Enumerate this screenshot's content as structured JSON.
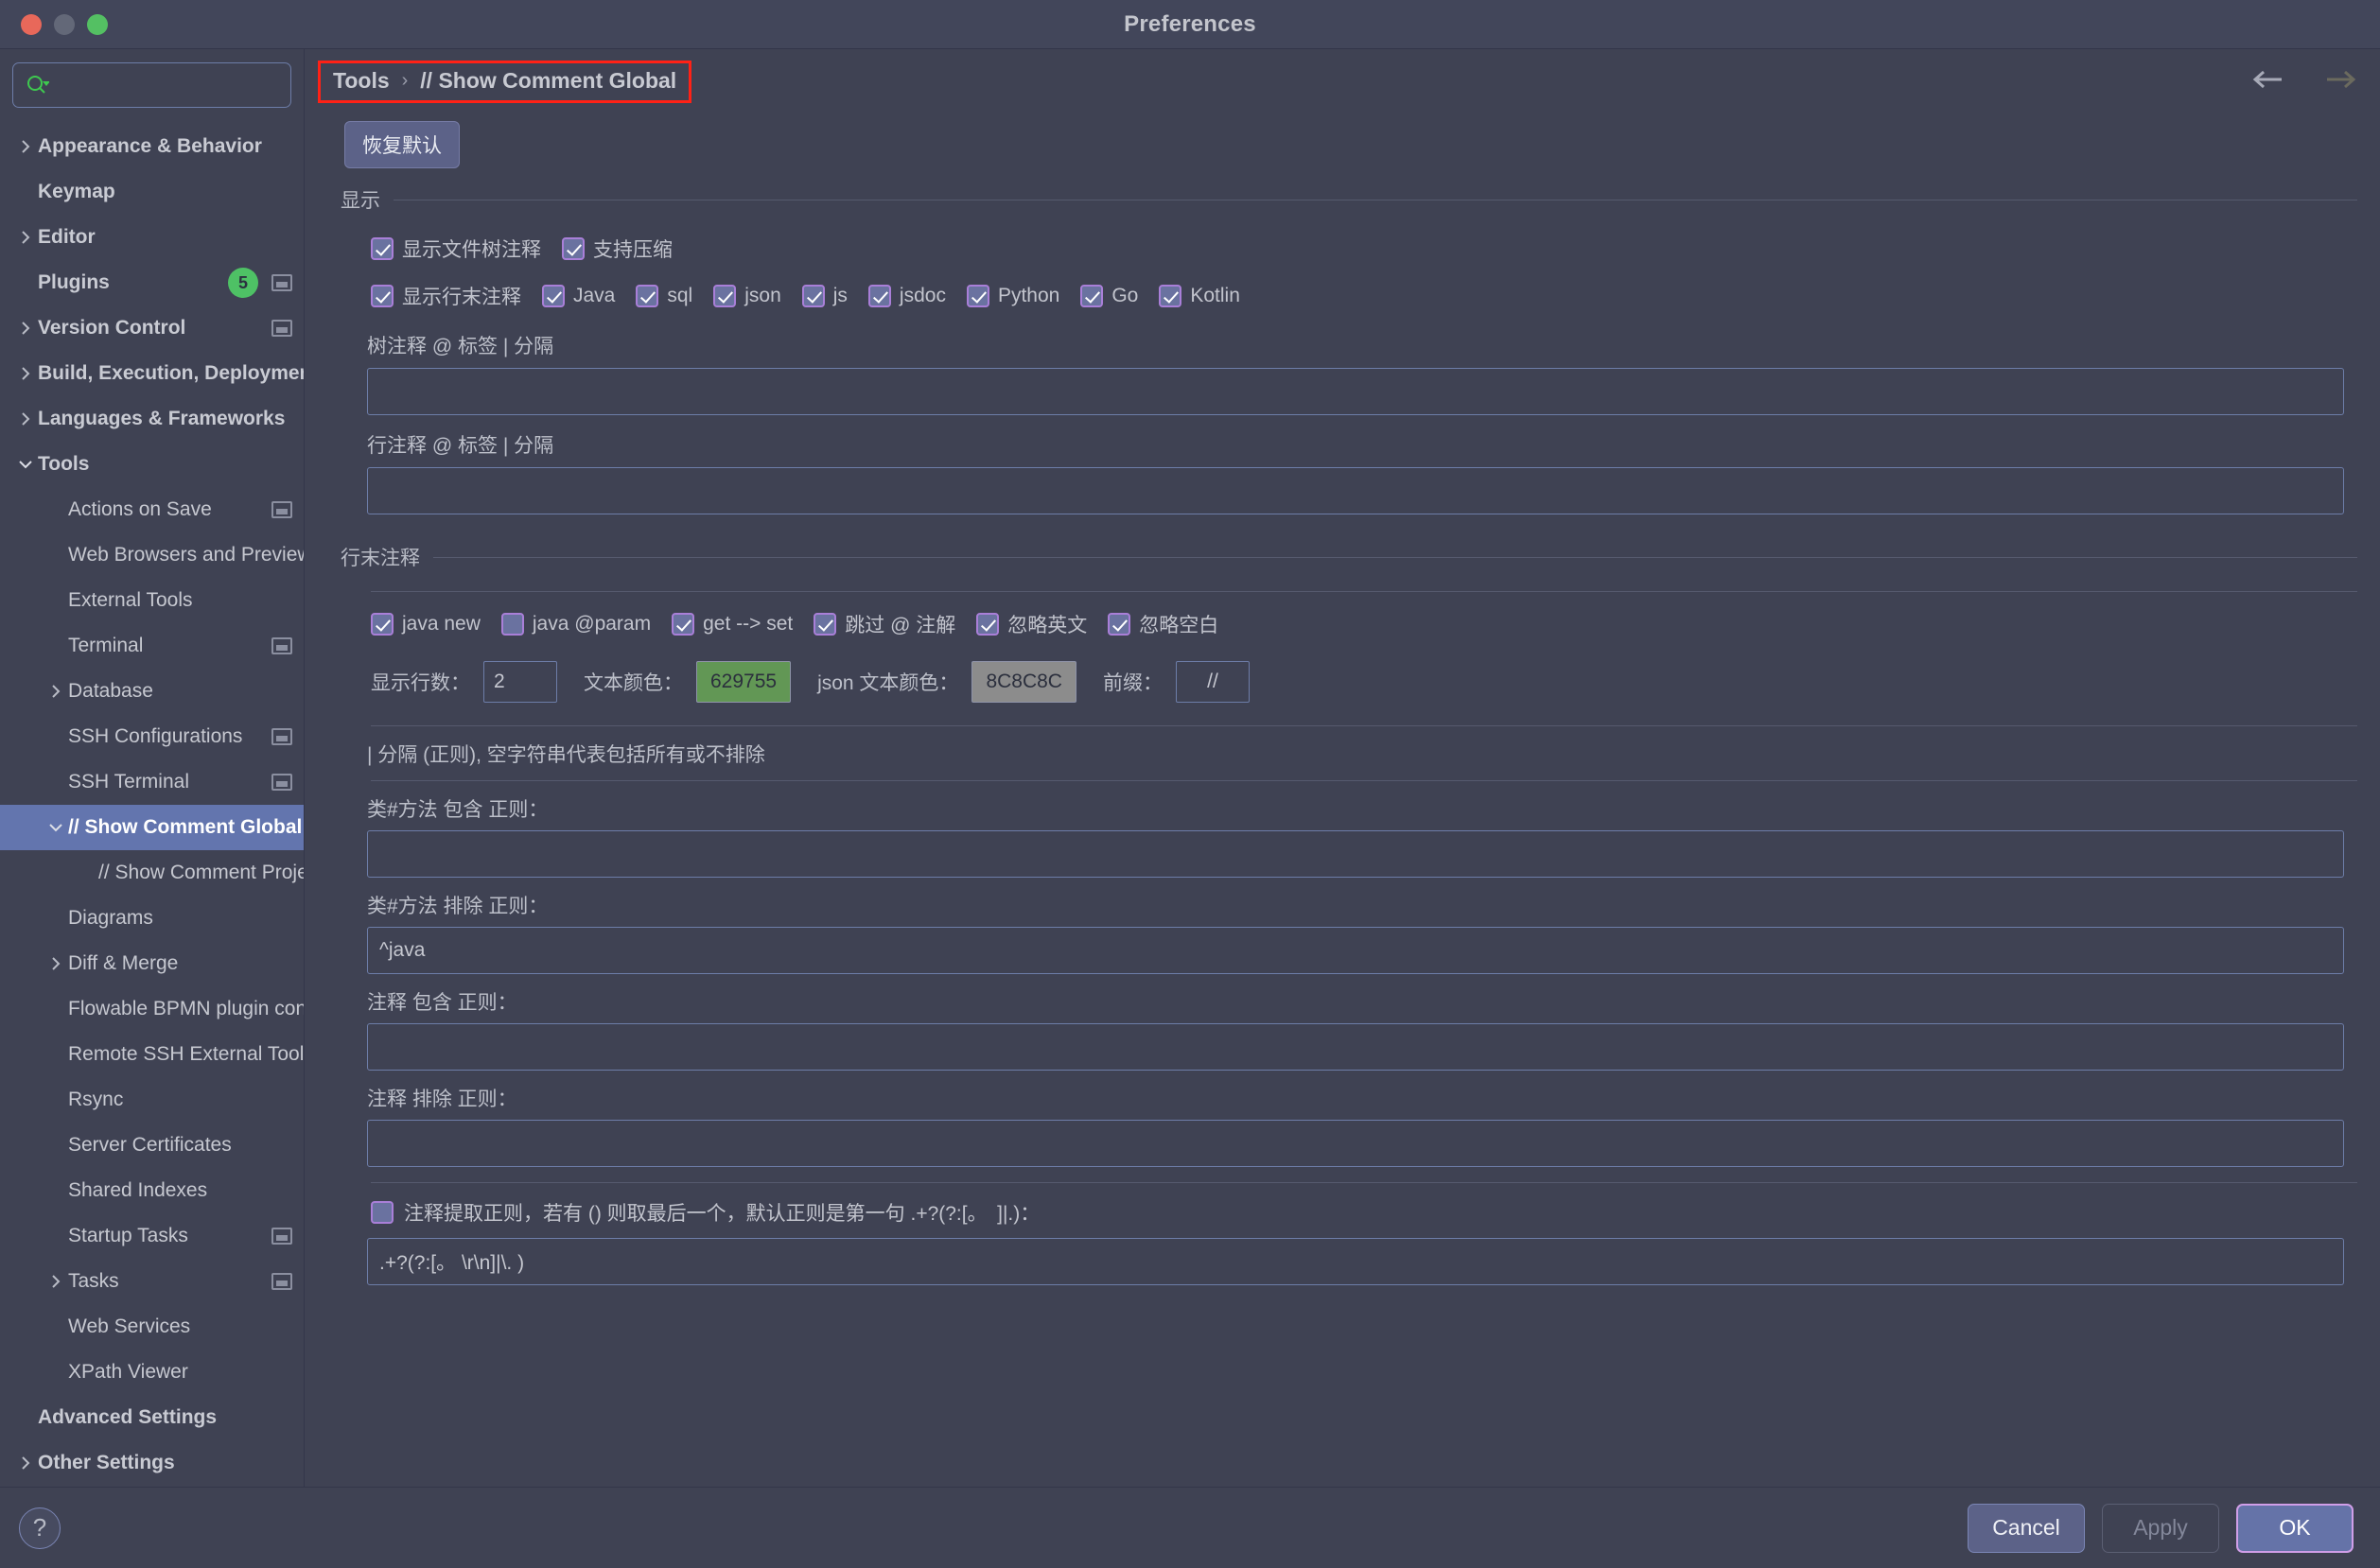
{
  "window": {
    "title": "Preferences"
  },
  "titlebar": {
    "close_label": "close",
    "minimize_label": "minimize",
    "maximize_label": "maximize"
  },
  "sidebar": {
    "search": {
      "value": "",
      "placeholder": ""
    },
    "items": [
      {
        "label": "Appearance & Behavior",
        "level": 0,
        "chevron": "right",
        "bold": true
      },
      {
        "label": "Keymap",
        "level": 0,
        "chevron": "none",
        "bold": true
      },
      {
        "label": "Editor",
        "level": 0,
        "chevron": "right",
        "bold": true
      },
      {
        "label": "Plugins",
        "level": 0,
        "chevron": "none",
        "bold": true,
        "badge": "5",
        "winicon": true
      },
      {
        "label": "Version Control",
        "level": 0,
        "chevron": "right",
        "bold": true,
        "winicon": true
      },
      {
        "label": "Build, Execution, Deployment",
        "level": 0,
        "chevron": "right",
        "bold": true
      },
      {
        "label": "Languages & Frameworks",
        "level": 0,
        "chevron": "right",
        "bold": true
      },
      {
        "label": "Tools",
        "level": 0,
        "chevron": "down",
        "bold": true
      },
      {
        "label": "Actions on Save",
        "level": 1,
        "chevron": "none",
        "winicon": true
      },
      {
        "label": "Web Browsers and Preview",
        "level": 1,
        "chevron": "none"
      },
      {
        "label": "External Tools",
        "level": 1,
        "chevron": "none"
      },
      {
        "label": "Terminal",
        "level": 1,
        "chevron": "none",
        "winicon": true
      },
      {
        "label": "Database",
        "level": 1,
        "chevron": "right"
      },
      {
        "label": "SSH Configurations",
        "level": 1,
        "chevron": "none",
        "winicon": true
      },
      {
        "label": "SSH Terminal",
        "level": 1,
        "chevron": "none",
        "winicon": true
      },
      {
        "label": "// Show Comment Global",
        "level": 1,
        "chevron": "down",
        "selected": true
      },
      {
        "label": "// Show Comment Project",
        "level": 2,
        "chevron": "none",
        "winicon": true
      },
      {
        "label": "Diagrams",
        "level": 1,
        "chevron": "none"
      },
      {
        "label": "Diff & Merge",
        "level": 1,
        "chevron": "right"
      },
      {
        "label": "Flowable BPMN plugin config",
        "level": 1,
        "chevron": "none"
      },
      {
        "label": "Remote SSH External Tools",
        "level": 1,
        "chevron": "none"
      },
      {
        "label": "Rsync",
        "level": 1,
        "chevron": "none"
      },
      {
        "label": "Server Certificates",
        "level": 1,
        "chevron": "none"
      },
      {
        "label": "Shared Indexes",
        "level": 1,
        "chevron": "none"
      },
      {
        "label": "Startup Tasks",
        "level": 1,
        "chevron": "none",
        "winicon": true
      },
      {
        "label": "Tasks",
        "level": 1,
        "chevron": "right",
        "winicon": true
      },
      {
        "label": "Web Services",
        "level": 1,
        "chevron": "none"
      },
      {
        "label": "XPath Viewer",
        "level": 1,
        "chevron": "none"
      },
      {
        "label": "Advanced Settings",
        "level": 0,
        "chevron": "none",
        "bold": true
      },
      {
        "label": "Other Settings",
        "level": 0,
        "chevron": "right",
        "bold": true
      }
    ]
  },
  "breadcrumb": {
    "root": "Tools",
    "separator": "›",
    "current": "// Show Comment Global",
    "highlight_color": "#ff2116"
  },
  "nav": {
    "back_icon": "arrow-left-icon",
    "forward_icon": "arrow-right-icon"
  },
  "main": {
    "restore_defaults": "恢复默认",
    "display_group": {
      "title": "显示",
      "row1": [
        {
          "label": "显示文件树注释",
          "checked": true
        },
        {
          "label": "支持压缩",
          "checked": true
        }
      ],
      "row2": [
        {
          "label": "显示行末注释",
          "checked": true
        },
        {
          "label": "Java",
          "checked": true
        },
        {
          "label": "sql",
          "checked": true
        },
        {
          "label": "json",
          "checked": true
        },
        {
          "label": "js",
          "checked": true
        },
        {
          "label": "jsdoc",
          "checked": true
        },
        {
          "label": "Python",
          "checked": true
        },
        {
          "label": "Go",
          "checked": true
        },
        {
          "label": "Kotlin",
          "checked": true
        }
      ],
      "tree_tag_label": "树注释 @ 标签 | 分隔",
      "tree_tag_value": "",
      "line_tag_label": "行注释 @ 标签 | 分隔",
      "line_tag_value": ""
    },
    "eol_group": {
      "title": "行末注释",
      "checkboxes": [
        {
          "label": "java new",
          "checked": true
        },
        {
          "label": "java @param",
          "checked": false
        },
        {
          "label": "get --> set",
          "checked": true
        },
        {
          "label": "跳过 @ 注解",
          "checked": true
        },
        {
          "label": "忽略英文",
          "checked": true
        },
        {
          "label": "忽略空白",
          "checked": true
        }
      ],
      "lines_label": "显示行数：",
      "lines_value": "2",
      "text_color_label": "文本颜色：",
      "text_color_value": "629755",
      "text_color_hex": "#629755",
      "json_color_label": "json 文本颜色：",
      "json_color_value": "8C8C8C",
      "json_color_hex": "#8C8C8C",
      "prefix_label": "前缀：",
      "prefix_value": "//",
      "hint": "| 分隔 (正则), 空字符串代表包括所有或不排除",
      "fields": [
        {
          "label": "类#方法 包含 正则：",
          "value": ""
        },
        {
          "label": "类#方法 排除 正则：",
          "value": "^java"
        },
        {
          "label": "注释 包含 正则：",
          "value": ""
        },
        {
          "label": "注释 排除 正则：",
          "value": ""
        }
      ],
      "extract": {
        "label": "注释提取正则，若有 () 则取最后一个，默认正则是第一句 .+?(?:[。　]|.)：",
        "checked": false,
        "value": ".+?(?:[。 \\r\\n]|\\. )"
      }
    }
  },
  "footer": {
    "help_label": "?",
    "cancel_label": "Cancel",
    "apply_label": "Apply",
    "ok_label": "OK"
  }
}
